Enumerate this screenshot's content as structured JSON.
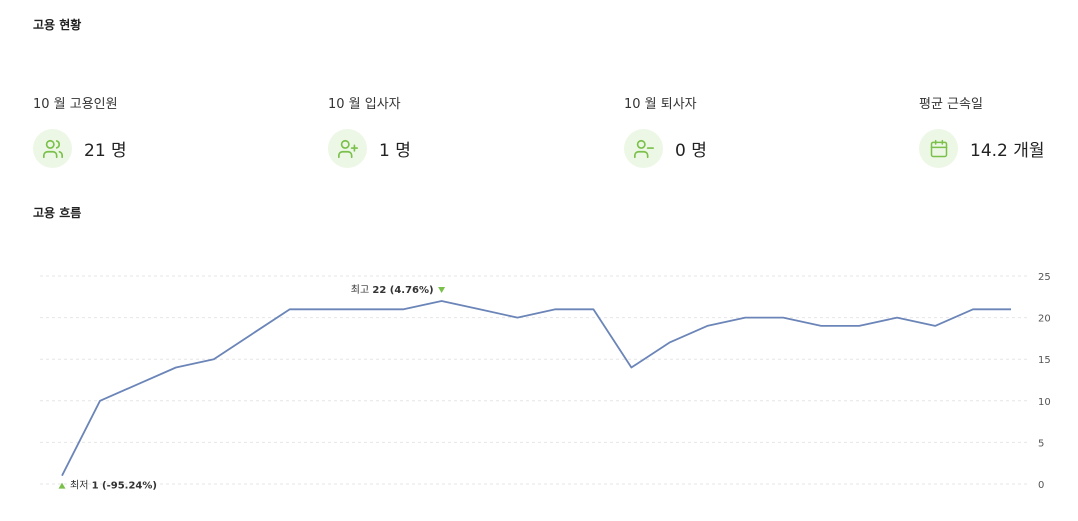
{
  "status_section": {
    "title": "고용 현황"
  },
  "stats": [
    {
      "label": "10 월 고용인원",
      "value": "21 명",
      "icon": "users-icon"
    },
    {
      "label": "10 월 입사자",
      "value": "1 명",
      "icon": "user-plus-icon"
    },
    {
      "label": "10 월 퇴사자",
      "value": "0 명",
      "icon": "user-minus-icon"
    },
    {
      "label": "평균 근속일",
      "value": "14.2 개월",
      "icon": "calendar-icon"
    }
  ],
  "flow_section": {
    "title": "고용 흐름"
  },
  "colors": {
    "line": "#6b85b8",
    "accent_green": "#7ac04a",
    "icon_bg": "#edf7e6",
    "grid": "#e6e6e6"
  },
  "chart_data": {
    "type": "line",
    "x": [
      1,
      2,
      3,
      4,
      5,
      6,
      7,
      8,
      9,
      10,
      11,
      12,
      13,
      14,
      15,
      16,
      17,
      18,
      19,
      20,
      21,
      22,
      23,
      24,
      25,
      26
    ],
    "series": [
      {
        "values": [
          1,
          10,
          12,
          14,
          15,
          18,
          21,
          21,
          21,
          21,
          22,
          21,
          20,
          21,
          21,
          14,
          17,
          19,
          20,
          20,
          19,
          19,
          20,
          19,
          21,
          21
        ]
      }
    ],
    "ylim": [
      0,
      25
    ],
    "yticks": [
      "0",
      "5",
      "10",
      "15",
      "20",
      "25"
    ],
    "y_axis_position": "right",
    "grid": true,
    "annotations": {
      "max_label": "최고",
      "max_value": "22 (4.76%)",
      "min_label": "최저",
      "min_value": "1 (-95.24%)"
    }
  }
}
